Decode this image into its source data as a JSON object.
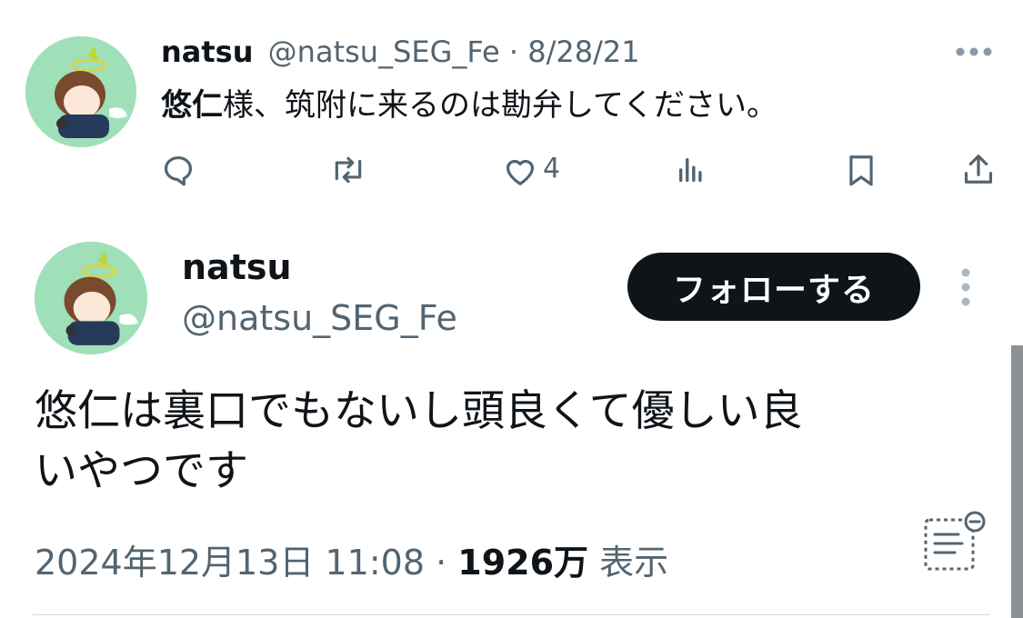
{
  "reply": {
    "display_name": "natsu",
    "handle": "@natsu_SEG_Fe",
    "separator": "·",
    "date": "8/28/21",
    "text_bold": "悠仁",
    "text_rest": "様、筑附に来るのは勘弁してください。",
    "actions": {
      "likes_count": "4"
    }
  },
  "tweet": {
    "display_name": "natsu",
    "handle": "@natsu_SEG_Fe",
    "follow_label": "フォローする",
    "body_line1": "悠仁は裏口でもないし頭良くて優しい良",
    "body_line2": "いやつです",
    "timestamp": "2024年12月13日 11:08",
    "meta_separator": "·",
    "views_count": "1926万",
    "views_label": "表示"
  },
  "colors": {
    "text": "#0f1419",
    "muted": "#536471",
    "button_bg": "#0f1419",
    "avatar_bg": "#9fe0b8"
  },
  "icons": [
    "more-horizontal-icon",
    "reply-icon",
    "retweet-icon",
    "like-icon",
    "views-icon",
    "bookmark-icon",
    "share-icon",
    "more-vertical-icon",
    "translate-notes-icon"
  ]
}
